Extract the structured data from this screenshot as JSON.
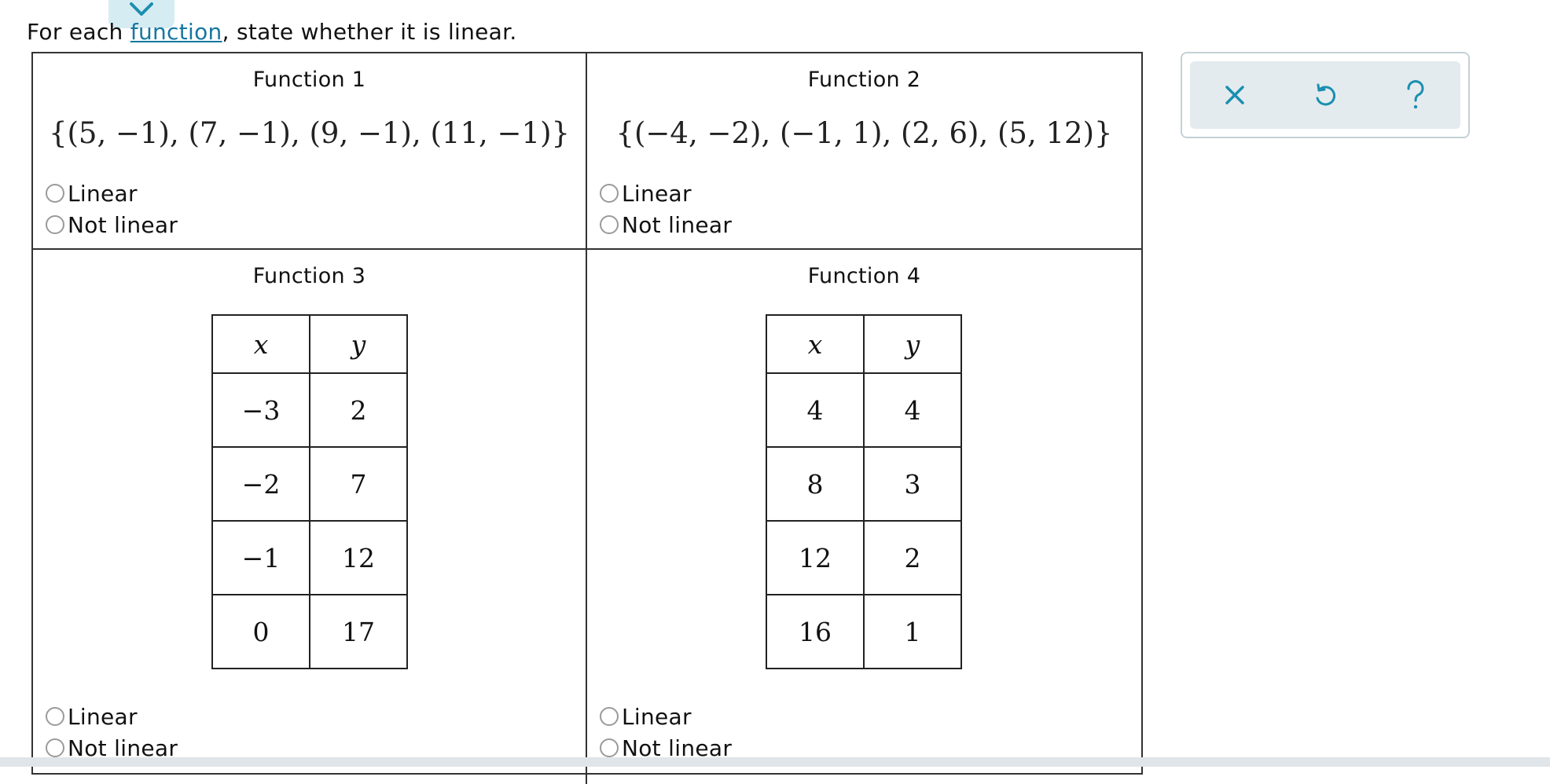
{
  "prompt": {
    "before": "For each ",
    "link": "function",
    "after": ", state whether it is linear."
  },
  "functions": [
    {
      "title": "Function 1",
      "set": "{(5, −1), (7, −1), (9, −1), (11, −1)}",
      "options": [
        "Linear",
        "Not linear"
      ]
    },
    {
      "title": "Function 2",
      "set": "{(−4, −2), (−1, 1), (2, 6), (5, 12)}",
      "options": [
        "Linear",
        "Not linear"
      ]
    },
    {
      "title": "Function 3",
      "headers": [
        "x",
        "y"
      ],
      "rows": [
        [
          "−3",
          "2"
        ],
        [
          "−2",
          "7"
        ],
        [
          "−1",
          "12"
        ],
        [
          "0",
          "17"
        ]
      ],
      "options": [
        "Linear",
        "Not linear"
      ]
    },
    {
      "title": "Function 4",
      "headers": [
        "x",
        "y"
      ],
      "rows": [
        [
          "4",
          "4"
        ],
        [
          "8",
          "3"
        ],
        [
          "12",
          "2"
        ],
        [
          "16",
          "1"
        ]
      ],
      "options": [
        "Linear",
        "Not linear"
      ]
    }
  ],
  "toolbar": {
    "buttons": [
      {
        "icon": "close-icon",
        "symbol": "×"
      },
      {
        "icon": "undo-icon",
        "symbol": "↺"
      },
      {
        "icon": "help-icon",
        "symbol": "?"
      }
    ]
  },
  "colors": {
    "link": "#1577a0",
    "tab": "#d6ecf3",
    "toolbar_bg": "#e4ebee",
    "icon": "#1a8fb0"
  }
}
